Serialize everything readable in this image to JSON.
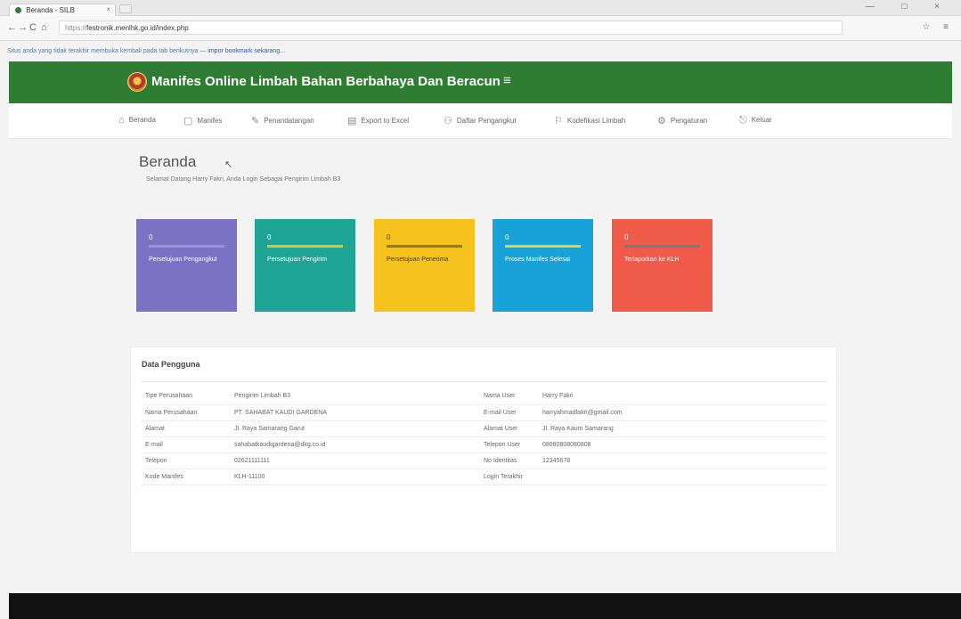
{
  "browser": {
    "tab_title": "Beranda - SILB",
    "tab_close": "×",
    "url_scheme": "https://",
    "url": "festronik.menlhk.go.id/index.php",
    "bookmarks_text": "Situs anda yang tidak terakhir membuka kembali pada tab berikutnya —",
    "bookmarks_link": "impor bookmark sekarang...",
    "window_controls": "— □ ×",
    "nav_back": "←",
    "nav_forward": "→",
    "nav_reload": "C",
    "nav_home": "⌂",
    "tool_icons": "☆ ≡"
  },
  "header": {
    "title": "Manifes Online Limbah Bahan Berbahaya Dan Beracun",
    "menu_toggle": "≡"
  },
  "menu": [
    {
      "icon": "⌂",
      "label": "Beranda"
    },
    {
      "icon": "▢",
      "label": "Manifes"
    },
    {
      "icon": "✎",
      "label": "Penandatangan"
    },
    {
      "icon": "▤",
      "label": "Export to Excel"
    },
    {
      "icon": "⚇",
      "label": "Daftar Pengangkut"
    },
    {
      "icon": "⚐",
      "label": "Kodefikasi Limbah"
    },
    {
      "icon": "⚙",
      "label": "Pengaturan"
    },
    {
      "icon": "⎋",
      "label": "Keluar"
    }
  ],
  "page": {
    "title": "Beranda",
    "cursor": "↖",
    "subtitle": "Selamat Datang Harry Fakri, Anda Login Sebagai Pengirim Limbah B3"
  },
  "cards": [
    {
      "value": "0",
      "label": "Persetujuan Pengangkut",
      "color": "#7b72c4",
      "bar": "#9a93d4"
    },
    {
      "value": "0",
      "label": "Persetujuan Pengirim",
      "color": "#1fa596",
      "bar": "#e8c22a"
    },
    {
      "value": "0",
      "label": "Persetujuan Penerima",
      "color": "#f5c21e",
      "bar": "#8a7a3a"
    },
    {
      "value": "0",
      "label": "Proses Manifes Selesai",
      "color": "#17a2d8",
      "bar": "#f0d030"
    },
    {
      "value": "0",
      "label": "Terlaporkan ke KLH",
      "color": "#f05a48",
      "bar": "#6a7d8a"
    }
  ],
  "user_panel": {
    "title": "Data Pengguna",
    "left_rows": [
      {
        "key": "Tipe Perusahaan",
        "value": "Pengirim Limbah B3"
      },
      {
        "key": "Nama Perusahaan",
        "value": "PT. SAHABAT KAUDI GARDENA"
      },
      {
        "key": "Alamat",
        "value": "Jl. Raya Samarang Garut"
      },
      {
        "key": "E-mail",
        "value": "sahabatkaudigardena@dkg.co.id"
      },
      {
        "key": "Telepon",
        "value": "02621111111"
      },
      {
        "key": "Kode Manifes",
        "value": "KLH-11100"
      }
    ],
    "right_rows": [
      {
        "key": "Nama User",
        "value": "Harry Fakri"
      },
      {
        "key": "E-mail User",
        "value": "harryahmadfakri@gmail.com"
      },
      {
        "key": "Alamat User",
        "value": "Jl. Raya Kaum Samarang"
      },
      {
        "key": "Telepon User",
        "value": "08080808080808"
      },
      {
        "key": "No Identitas",
        "value": "12345678"
      },
      {
        "key": "Login Terakhir",
        "value": ""
      }
    ]
  }
}
